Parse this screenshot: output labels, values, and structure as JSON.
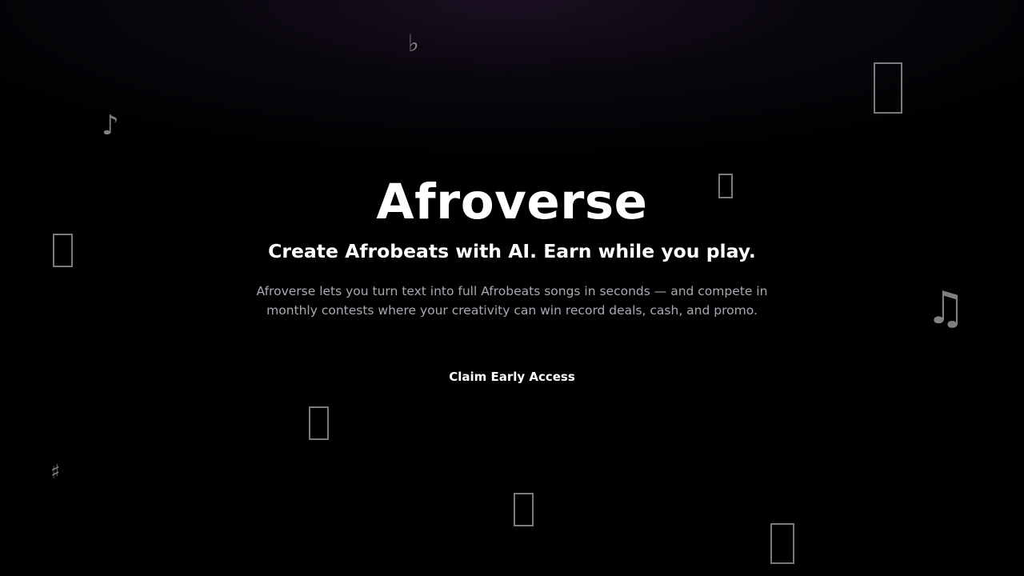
{
  "hero": {
    "title": "Afroverse",
    "tagline": "Create Afrobeats with AI. Earn while you play.",
    "description": "Afroverse lets you turn text into full Afrobeats songs in seconds — and compete in monthly contests where your creativity can win record deals, cash, and promo.",
    "cta_label": "Claim Early Access"
  },
  "decor": {
    "glyphs": [
      "♭",
      "♪",
      "♫",
      "♯"
    ],
    "icons": [
      "flat-note-icon",
      "eighth-note-icon",
      "beamed-notes-icon",
      "sharp-icon",
      "missing-glyph-box-icon"
    ]
  },
  "colors": {
    "background": "#000000",
    "title": "#ffffff",
    "body_text": "#a9a9b3",
    "decor": "rgba(255,255,255,0.5)"
  }
}
